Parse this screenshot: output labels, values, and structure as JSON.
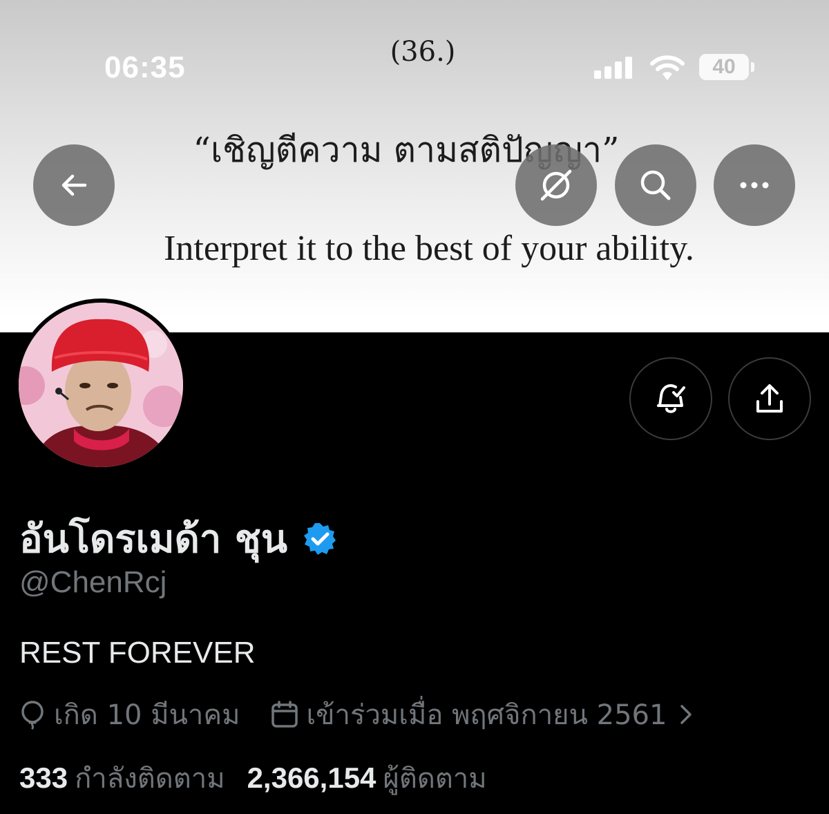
{
  "status_bar": {
    "time": "06:35",
    "battery": "40"
  },
  "banner": {
    "number": "(36.)",
    "thai_quote": "“เชิญตีความ ตามสติปัญญา”",
    "english_quote": "Interpret it to the best of your ability."
  },
  "toolbar": {
    "icons": [
      "back-arrow-icon",
      "grok-icon",
      "search-icon",
      "more-icon"
    ]
  },
  "profile_actions": {
    "icons": [
      "notification-bell-icon",
      "share-icon"
    ]
  },
  "profile": {
    "display_name": "อันโดรเมด้า ชุน",
    "handle": "@ChenRcj",
    "bio": "REST FOREVER",
    "birthday": "เกิด 10 มีนาคม",
    "joined": "เข้าร่วมเมื่อ พฤศจิกายน 2561",
    "following_count": "333",
    "following_label": "กำลังติดตาม",
    "followers_count": "2,366,154",
    "followers_label": "ผู้ติดตาม"
  },
  "colors": {
    "background": "#000000",
    "primary_text": "#e7e9ea",
    "secondary_text": "#71767b",
    "verified_badge": "#1d9bf0"
  }
}
